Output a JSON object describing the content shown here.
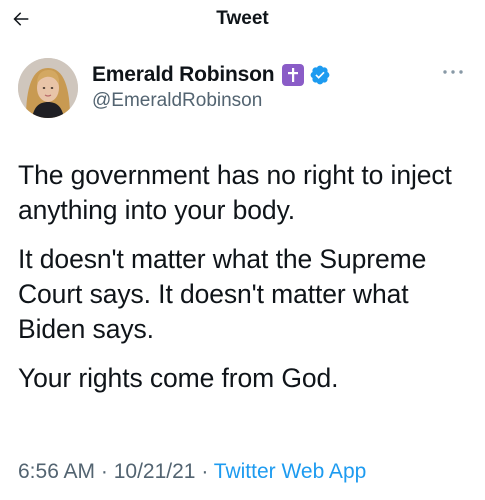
{
  "header": {
    "back_icon": "arrow-left-icon",
    "title": "Tweet"
  },
  "author": {
    "avatar_icon": "profile-avatar",
    "display_name": "Emerald Robinson",
    "badge_icon": "latin-cross-icon",
    "verified_icon": "verified-badge-icon",
    "handle": "@EmeraldRobinson"
  },
  "more_icon": "more-options-icon",
  "tweet": {
    "paragraphs": [
      "The government has no right to inject anything into your body.",
      "It doesn't matter what the Supreme Court says. It doesn't matter what Biden says.",
      "Your rights come from God."
    ]
  },
  "meta": {
    "time": "6:56 AM",
    "separator": " · ",
    "date": "10/21/21",
    "source": "Twitter Web App"
  },
  "colors": {
    "text": "#0f1419",
    "secondary": "#536471",
    "accent": "#1d9bf0",
    "badge": "#8a5cc7"
  }
}
